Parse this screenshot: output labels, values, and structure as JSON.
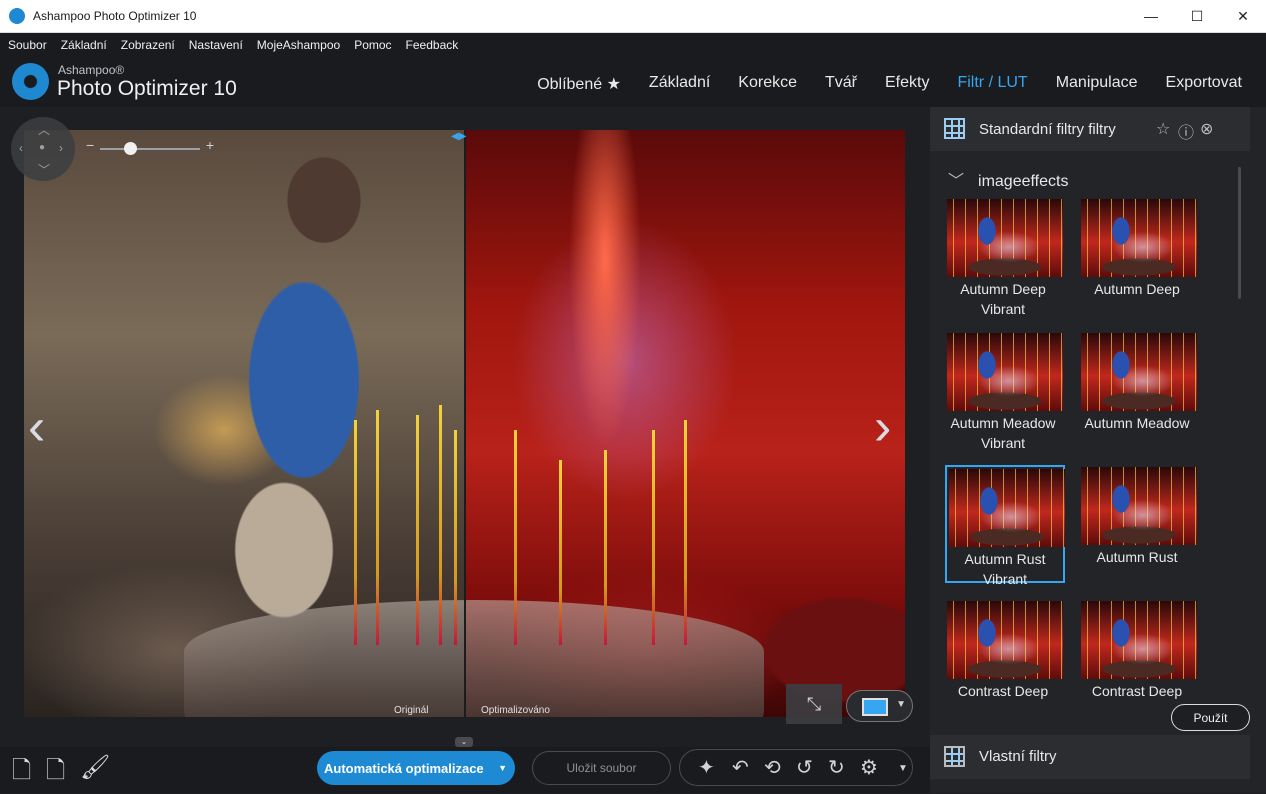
{
  "window": {
    "title": "Ashampoo Photo Optimizer 10",
    "minimize": "—",
    "maximize": "☐",
    "close": "✕"
  },
  "menu": [
    "Soubor",
    "Základní",
    "Zobrazení",
    "Nastavení",
    "MojeAshampoo",
    "Pomoc",
    "Feedback"
  ],
  "brand": {
    "small": "Ashampoo®",
    "big": "Photo Optimizer 10"
  },
  "topnav": [
    {
      "label": "Oblíbené ★",
      "active": false
    },
    {
      "label": "Základní",
      "active": false
    },
    {
      "label": "Korekce",
      "active": false
    },
    {
      "label": "Tvář",
      "active": false
    },
    {
      "label": "Efekty",
      "active": false
    },
    {
      "label": "Filtr / LUT",
      "active": true
    },
    {
      "label": "Manipulace",
      "active": false
    },
    {
      "label": "Exportovat",
      "active": false
    }
  ],
  "viewer": {
    "label_original": "Originál",
    "label_optimized": "Optimalizováno",
    "zoom_minus": "−",
    "zoom_plus": "+",
    "zoom_level": 0.3,
    "prev_arrow": "‹",
    "next_arrow": "›"
  },
  "bottombar": {
    "auto_label": "Automatická optimalizace",
    "save_label": "Uložit soubor"
  },
  "panel": {
    "title": "Standardní filtry filtry",
    "section": "imageeffects",
    "filters": [
      {
        "label": "Autumn Deep Vibrant",
        "selected": false
      },
      {
        "label": "Autumn Deep",
        "selected": false
      },
      {
        "label": "Autumn Meadow Vibrant",
        "selected": false
      },
      {
        "label": "Autumn Meadow",
        "selected": false
      },
      {
        "label": "Autumn Rust Vibrant",
        "selected": true
      },
      {
        "label": "Autumn Rust",
        "selected": false
      },
      {
        "label": "Contrast Deep",
        "selected": false
      },
      {
        "label": "Contrast Deep",
        "selected": false
      }
    ],
    "apply_label": "Použít",
    "custom_title": "Vlastní filtry"
  },
  "colors": {
    "accent": "#36a6f0",
    "button_blue": "#1f8ad4",
    "background": "#1e1f22"
  }
}
